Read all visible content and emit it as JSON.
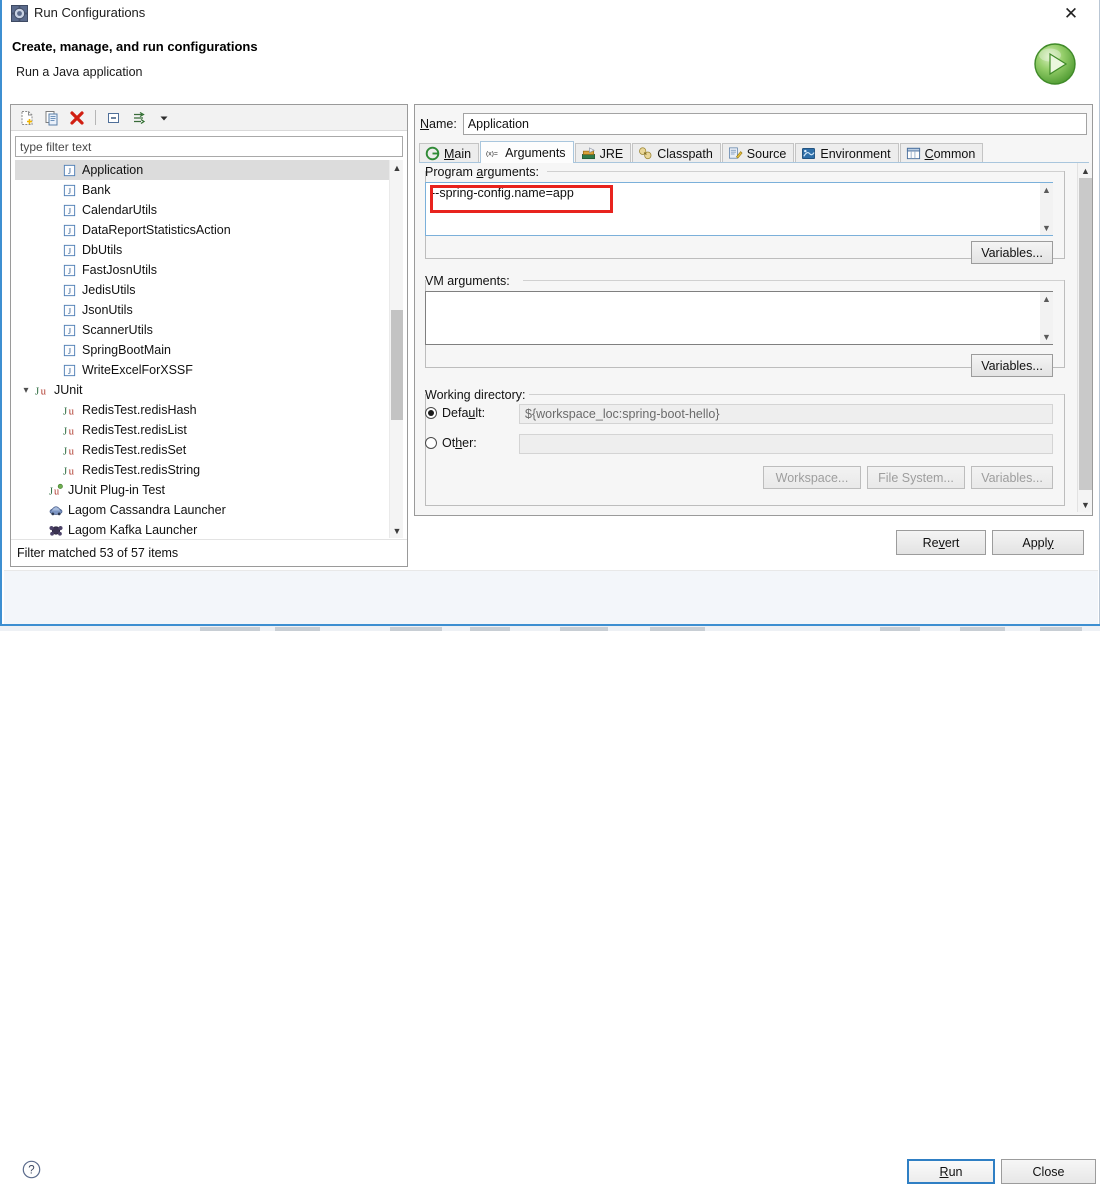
{
  "window": {
    "title": "Run Configurations",
    "title_icon": "run-configurations-icon",
    "close_icon": "close-icon"
  },
  "header": {
    "title": "Create, manage, and run configurations",
    "subtitle": "Run a Java application",
    "badge_icon": "green-run-play-icon"
  },
  "left_panel": {
    "toolbar": [
      {
        "name": "new-configuration-button",
        "icon": "new-document-icon"
      },
      {
        "name": "duplicate-configuration-button",
        "icon": "copy-document-icon"
      },
      {
        "name": "delete-configuration-button",
        "icon": "red-x-delete-icon"
      },
      {
        "name": "collapse-all-button",
        "icon": "collapse-all-icon"
      },
      {
        "name": "filter-configurations-button",
        "icon": "filter-arrows-icon"
      },
      {
        "name": "filter-dropdown-button",
        "icon": "chevron-down-icon"
      }
    ],
    "filter": {
      "placeholder": "type filter text",
      "value": ""
    },
    "tree": [
      {
        "label": "Application",
        "icon": "java-app-icon",
        "indent": 2,
        "selected": true,
        "twisty": ""
      },
      {
        "label": "Bank",
        "icon": "java-app-icon",
        "indent": 2,
        "selected": false,
        "twisty": ""
      },
      {
        "label": "CalendarUtils",
        "icon": "java-app-icon",
        "indent": 2,
        "selected": false,
        "twisty": ""
      },
      {
        "label": "DataReportStatisticsAction",
        "icon": "java-app-icon",
        "indent": 2,
        "selected": false,
        "twisty": ""
      },
      {
        "label": "DbUtils",
        "icon": "java-app-icon",
        "indent": 2,
        "selected": false,
        "twisty": ""
      },
      {
        "label": "FastJosnUtils",
        "icon": "java-app-icon",
        "indent": 2,
        "selected": false,
        "twisty": ""
      },
      {
        "label": "JedisUtils",
        "icon": "java-app-icon",
        "indent": 2,
        "selected": false,
        "twisty": ""
      },
      {
        "label": "JsonUtils",
        "icon": "java-app-icon",
        "indent": 2,
        "selected": false,
        "twisty": ""
      },
      {
        "label": "ScannerUtils",
        "icon": "java-app-icon",
        "indent": 2,
        "selected": false,
        "twisty": ""
      },
      {
        "label": "SpringBootMain",
        "icon": "java-app-icon",
        "indent": 2,
        "selected": false,
        "twisty": ""
      },
      {
        "label": "WriteExcelForXSSF",
        "icon": "java-app-icon",
        "indent": 2,
        "selected": false,
        "twisty": ""
      },
      {
        "label": "JUnit",
        "icon": "junit-icon",
        "indent": 0,
        "selected": false,
        "twisty": "expanded"
      },
      {
        "label": "RedisTest.redisHash",
        "icon": "junit-icon",
        "indent": 2,
        "selected": false,
        "twisty": ""
      },
      {
        "label": "RedisTest.redisList",
        "icon": "junit-icon",
        "indent": 2,
        "selected": false,
        "twisty": ""
      },
      {
        "label": "RedisTest.redisSet",
        "icon": "junit-icon",
        "indent": 2,
        "selected": false,
        "twisty": ""
      },
      {
        "label": "RedisTest.redisString",
        "icon": "junit-icon",
        "indent": 2,
        "selected": false,
        "twisty": ""
      },
      {
        "label": "JUnit Plug-in Test",
        "icon": "junit-plugin-icon",
        "indent": 1,
        "selected": false,
        "twisty": ""
      },
      {
        "label": "Lagom Cassandra Launcher",
        "icon": "lagom-cassandra-icon",
        "indent": 1,
        "selected": false,
        "twisty": ""
      },
      {
        "label": "Lagom Kafka Launcher",
        "icon": "lagom-kafka-icon",
        "indent": 1,
        "selected": false,
        "twisty": ""
      }
    ],
    "status": "Filter matched 53 of 57 items"
  },
  "right_panel": {
    "name_label": "Name:",
    "name_value": "Application",
    "tabs": [
      {
        "label": "Main",
        "icon": "main-green-circle-icon",
        "active": false,
        "mnemonic": "M"
      },
      {
        "label": "Arguments",
        "icon": "arguments-xequals-icon",
        "active": true,
        "mnemonic": ""
      },
      {
        "label": "JRE",
        "icon": "jre-library-icon",
        "active": false,
        "mnemonic": ""
      },
      {
        "label": "Classpath",
        "icon": "classpath-jars-icon",
        "active": false,
        "mnemonic": ""
      },
      {
        "label": "Source",
        "icon": "source-pencil-icon",
        "active": false,
        "mnemonic": ""
      },
      {
        "label": "Environment",
        "icon": "environment-icon",
        "active": false,
        "mnemonic": ""
      },
      {
        "label": "Common",
        "icon": "common-window-icon",
        "active": false,
        "mnemonic": "C"
      }
    ],
    "program_arguments": {
      "label": "Program arguments:",
      "value": "--spring-config.name=app",
      "variables_button": "Variables..."
    },
    "vm_arguments": {
      "label": "VM arguments:",
      "value": "",
      "variables_button": "Variables..."
    },
    "working_directory": {
      "label": "Working directory:",
      "default_radio_label": "Default:",
      "default_value": "${workspace_loc:spring-boot-hello}",
      "default_selected": true,
      "other_radio_label": "Other:",
      "other_value": "",
      "other_selected": false,
      "buttons": [
        {
          "label": "Workspace...",
          "enabled": false
        },
        {
          "label": "File System...",
          "enabled": false
        },
        {
          "label": "Variables...",
          "enabled": false
        }
      ]
    }
  },
  "footer": {
    "revert_label": "Revert",
    "apply_label": "Apply",
    "run_label": "Run",
    "close_label": "Close",
    "help_icon": "help-question-icon"
  },
  "annotation": {
    "highlight_color": "#e8231e",
    "highlight_target": "program-arguments-value"
  }
}
